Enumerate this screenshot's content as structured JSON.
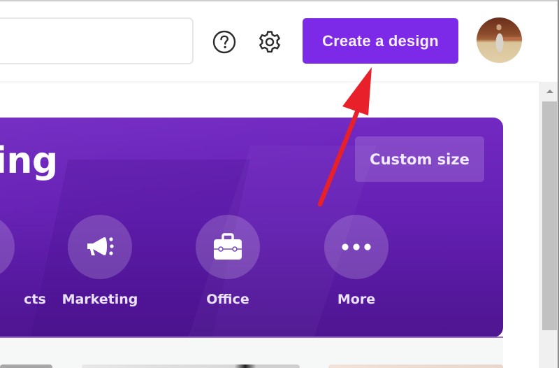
{
  "header": {
    "search": {
      "value": "",
      "placeholder": ""
    },
    "help_icon": "help-circle-icon",
    "settings_icon": "gear-icon",
    "create_button_label": "Create a design",
    "avatar_alt": "User profile photo"
  },
  "banner": {
    "title_visible": "ing",
    "custom_size_label": "Custom size",
    "categories": [
      {
        "label": "cts",
        "icon": "products-icon"
      },
      {
        "label": "Marketing",
        "icon": "megaphone-icon"
      },
      {
        "label": "Office",
        "icon": "briefcase-icon"
      },
      {
        "label": "More",
        "icon": "more-dots-icon"
      }
    ]
  },
  "annotation": {
    "type": "arrow",
    "color": "#e8202a",
    "points_to": "Create a design"
  },
  "colors": {
    "brand_purple": "#7d2ae8",
    "banner_purple": "#6520b3",
    "annotation_red": "#e8202a"
  }
}
